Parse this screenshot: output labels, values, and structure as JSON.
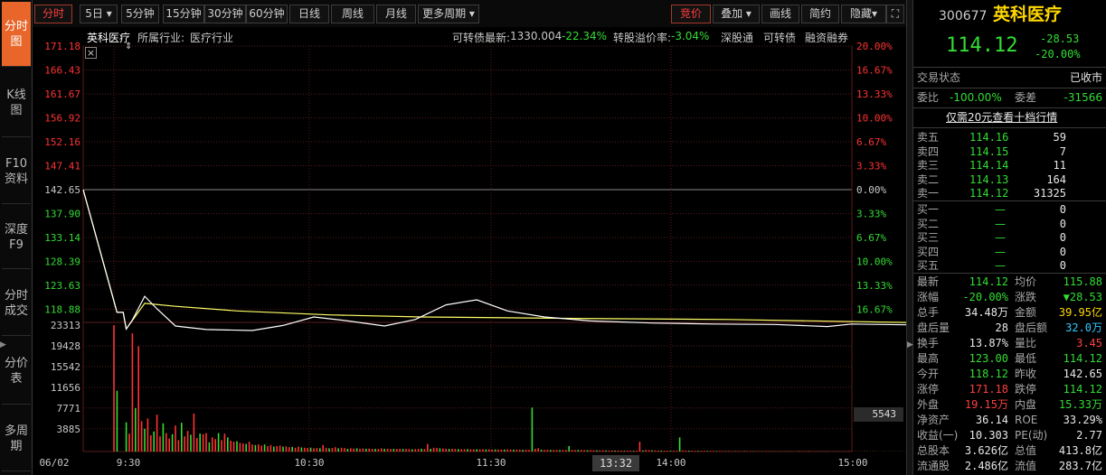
{
  "left_tabs": [
    {
      "label": "分时图",
      "active": true
    },
    {
      "label": "K线图",
      "active": false
    },
    {
      "label": "F10资料",
      "active": false
    },
    {
      "label": "深度F9",
      "active": false
    },
    {
      "label": "分时成交",
      "active": false
    },
    {
      "label": "分价表",
      "active": false
    },
    {
      "label": "多周期",
      "active": false
    }
  ],
  "toolbar": {
    "fenshi": "分时",
    "five_day": "5日",
    "five_day_arrow": "▾",
    "m5": "5分钟",
    "m15": "15分钟",
    "m30": "30分钟",
    "m60": "60分钟",
    "day": "日线",
    "week": "周线",
    "month": "月线",
    "more": "更多周期",
    "more_arrow": "▾",
    "jingjia": "竞价",
    "diejia": "叠加",
    "diejia_arrow": "▾",
    "huaxian": "画线",
    "jianyue": "简约",
    "yincang": "隐藏",
    "yincang_arrow": "▾",
    "fullscreen_icon": "⛶"
  },
  "infobar": {
    "stock_name": "英科医疗",
    "industry_label": "所属行业:",
    "industry_value": "医疗行业",
    "convert_label": "可转债最新:",
    "convert_price": "1330.004",
    "convert_pct": "-22.34%",
    "premium_label": "转股溢价率:",
    "premium_value": "-3.04%",
    "link1": "深股通",
    "link2": "可转债",
    "link3": "融资融券"
  },
  "chart_data": {
    "type": "line",
    "price_axis": {
      "labels": [
        "171.18",
        "166.43",
        "161.67",
        "156.92",
        "152.16",
        "147.41",
        "142.65",
        "137.90",
        "133.14",
        "128.39",
        "123.63",
        "118.88"
      ],
      "pct_labels": [
        "20.00%",
        "16.67%",
        "13.33%",
        "10.00%",
        "6.67%",
        "3.33%",
        "0.00%",
        "3.33%",
        "6.67%",
        "10.00%",
        "13.33%",
        "16.67%"
      ],
      "prev_close": 142.65,
      "ylim": [
        114.12,
        171.18
      ]
    },
    "volume_axis": {
      "labels": [
        "23313",
        "19428",
        "15542",
        "11656",
        "7771",
        "3885"
      ],
      "ylim": [
        0,
        23313
      ]
    },
    "x_labels": [
      "06/02",
      "9:30",
      "10:30",
      "11:30",
      "13:32",
      "14:00",
      "15:00"
    ],
    "price_series": {
      "name": "price",
      "values": [
        [
          0,
          142.65
        ],
        [
          1,
          118.3
        ],
        [
          3,
          118.3
        ],
        [
          4,
          115.0
        ],
        [
          6,
          116.8
        ],
        [
          10,
          121.5
        ],
        [
          14,
          119.0
        ],
        [
          20,
          115.6
        ],
        [
          30,
          114.9
        ],
        [
          45,
          114.7
        ],
        [
          55,
          115.7
        ],
        [
          65,
          117.4
        ],
        [
          75,
          116.7
        ],
        [
          88,
          115.6
        ],
        [
          98,
          116.9
        ],
        [
          108,
          119.8
        ],
        [
          118,
          120.8
        ],
        [
          128,
          118.6
        ],
        [
          140,
          117.4
        ],
        [
          155,
          116.6
        ],
        [
          175,
          116.2
        ],
        [
          195,
          116.0
        ],
        [
          215,
          115.9
        ],
        [
          232,
          115.5
        ],
        [
          240,
          116.0
        ],
        [
          262,
          115.8
        ],
        [
          268,
          114.4
        ],
        [
          420,
          114.12
        ]
      ]
    },
    "avg_series": {
      "name": "avg",
      "values": [
        [
          0,
          142.65
        ],
        [
          1,
          118.3
        ],
        [
          3,
          118.3
        ],
        [
          4,
          115.0
        ],
        [
          10,
          120.1
        ],
        [
          20,
          119.5
        ],
        [
          40,
          118.6
        ],
        [
          70,
          117.8
        ],
        [
          100,
          117.4
        ],
        [
          150,
          117.1
        ],
        [
          200,
          116.9
        ],
        [
          268,
          116.2
        ],
        [
          300,
          116.1
        ],
        [
          420,
          115.88
        ]
      ]
    },
    "volume_bars": [
      23313,
      11200,
      0,
      0,
      5400,
      3300,
      21800,
      8000,
      19400,
      5600,
      4200,
      6100,
      3000,
      3700,
      6800,
      2800,
      5200,
      3400,
      2400,
      3200,
      4800,
      2100,
      5300,
      2800,
      3800,
      3100,
      7000,
      2500,
      3300,
      3200,
      3400,
      1700,
      2600,
      2300,
      3400,
      2100,
      3300,
      2600,
      2000,
      1800,
      1900,
      1600,
      1500,
      1400,
      1800,
      1300,
      1200,
      1300,
      1100,
      1300,
      1000,
      1200,
      900,
      1000,
      1100,
      900,
      950,
      800,
      850,
      700,
      900,
      750,
      700,
      650,
      700,
      600,
      650,
      600,
      1200,
      700,
      600,
      650,
      800,
      600,
      700,
      650,
      500,
      600,
      550,
      600,
      500,
      560,
      520,
      540,
      500,
      500,
      480,
      600,
      500,
      520,
      460,
      500,
      480,
      500,
      470,
      480,
      460,
      400,
      450,
      480,
      520,
      460,
      1400,
      500,
      700,
      650,
      600,
      560,
      520,
      480,
      500,
      470,
      460,
      440,
      430,
      460,
      420,
      400,
      420,
      400,
      410,
      400,
      400,
      380,
      390,
      380,
      350,
      360,
      400,
      380,
      350,
      340,
      330,
      320,
      340,
      300,
      8100,
      500,
      600,
      350,
      300,
      320,
      300,
      280,
      290,
      260,
      270,
      280,
      1000,
      300,
      280,
      300,
      280,
      260,
      250,
      270,
      230,
      220,
      210,
      240,
      200,
      190,
      200,
      180,
      190,
      170,
      160,
      180,
      170,
      150,
      160,
      1800,
      200,
      300,
      250,
      220,
      200,
      180,
      170,
      160,
      150,
      140,
      150,
      130,
      2600,
      200,
      180,
      160,
      150,
      140,
      130,
      140,
      130,
      120,
      110,
      120,
      100,
      110,
      100,
      90,
      100,
      90,
      80,
      90,
      80,
      100,
      90,
      80,
      70,
      60,
      70,
      60,
      80,
      70,
      60,
      50,
      60,
      50,
      60,
      70,
      60,
      50,
      60,
      70,
      60,
      80,
      70,
      60,
      50,
      60,
      50,
      60,
      50,
      40,
      50,
      40,
      50,
      40,
      50,
      60,
      50,
      40,
      50,
      40,
      60,
      50,
      40,
      50,
      40,
      30,
      40,
      30,
      40,
      30,
      40,
      30,
      40,
      30,
      40,
      30,
      40,
      30,
      40,
      30,
      40,
      30,
      40,
      30,
      40,
      50,
      60,
      50,
      40,
      50,
      40,
      50,
      40,
      30,
      40,
      30,
      40,
      30,
      40,
      30,
      40,
      30,
      40,
      30,
      40,
      30,
      40,
      30,
      40,
      30,
      40,
      30,
      40,
      30,
      40,
      30,
      40,
      30,
      40,
      30,
      40,
      30,
      40,
      30,
      40,
      30,
      40,
      30,
      40,
      30,
      40,
      30,
      40,
      30,
      40,
      30,
      40,
      30,
      40,
      30,
      40,
      30,
      40,
      30,
      40,
      30,
      40,
      30,
      40,
      30,
      40,
      30,
      40,
      30,
      40,
      30,
      40,
      30,
      40,
      30,
      40,
      30,
      40,
      30,
      40,
      30,
      40,
      30,
      40,
      30,
      40,
      30,
      40,
      30,
      40,
      30,
      40,
      30,
      40,
      30,
      40,
      30,
      40,
      30,
      40,
      30,
      40,
      30,
      40,
      30,
      40,
      30,
      40,
      30,
      40,
      30,
      40,
      30,
      40,
      30,
      40,
      30,
      40,
      30,
      40,
      30,
      40,
      30,
      40,
      30,
      40,
      30,
      40,
      30,
      40,
      30,
      40,
      30,
      40,
      30,
      40,
      30,
      40,
      30,
      40,
      30,
      40,
      30,
      40,
      30,
      40,
      30,
      40,
      30,
      40,
      30,
      40,
      30,
      40,
      30,
      40,
      30,
      40,
      30,
      40,
      30,
      40,
      30,
      40,
      30,
      40,
      30,
      40,
      30,
      40,
      30
    ],
    "volume_colors_note": "red-up-green-down",
    "current_volume": "5543",
    "crosshair_time": "13:32",
    "colors": {
      "price_line": "#ffffff",
      "avg_line": "#ffff66",
      "up": "#ff3333",
      "down": "#33dd33",
      "grid": "#5a1a1a"
    }
  },
  "right_panel": {
    "code": "300677",
    "name": "英科医疗",
    "price": "114.12",
    "change": "-28.53",
    "change_pct": "-20.00%",
    "status_label": "交易状态",
    "status_value": "已收市",
    "weibi_label": "委比",
    "weibi_value": "-100.00%",
    "weicha_label": "委差",
    "weicha_value": "-31566",
    "promo": "仅需20元查看十档行情",
    "sells": [
      {
        "label": "卖五",
        "price": "114.16",
        "vol": "59"
      },
      {
        "label": "卖四",
        "price": "114.15",
        "vol": "7"
      },
      {
        "label": "卖三",
        "price": "114.14",
        "vol": "11"
      },
      {
        "label": "卖二",
        "price": "114.13",
        "vol": "164"
      },
      {
        "label": "卖一",
        "price": "114.12",
        "vol": "31325"
      }
    ],
    "buys": [
      {
        "label": "买一",
        "price": "—",
        "vol": "0"
      },
      {
        "label": "买二",
        "price": "—",
        "vol": "0"
      },
      {
        "label": "买三",
        "price": "—",
        "vol": "0"
      },
      {
        "label": "买四",
        "price": "—",
        "vol": "0"
      },
      {
        "label": "买五",
        "price": "—",
        "vol": "0"
      }
    ],
    "stats": [
      {
        "l1": "最新",
        "v1": "114.12",
        "c1": "green",
        "l2": "均价",
        "v2": "115.88",
        "c2": "green"
      },
      {
        "l1": "涨幅",
        "v1": "-20.00%",
        "c1": "green",
        "l2": "涨跌",
        "v2": "▼28.53",
        "c2": "green"
      },
      {
        "l1": "总手",
        "v1": "34.48万",
        "c1": "white",
        "l2": "金额",
        "v2": "39.95亿",
        "c2": "yellow"
      },
      {
        "l1": "盘后量",
        "v1": "28",
        "c1": "white",
        "l2": "盘后额",
        "v2": "32.0万",
        "c2": "cyan"
      },
      {
        "l1": "换手",
        "v1": "13.87%",
        "c1": "white",
        "l2": "量比",
        "v2": "3.45",
        "c2": "red-t"
      },
      {
        "l1": "最高",
        "v1": "123.00",
        "c1": "green",
        "l2": "最低",
        "v2": "114.12",
        "c2": "green"
      },
      {
        "l1": "今开",
        "v1": "118.12",
        "c1": "green",
        "l2": "昨收",
        "v2": "142.65",
        "c2": "white"
      },
      {
        "l1": "涨停",
        "v1": "171.18",
        "c1": "red-t",
        "l2": "跌停",
        "v2": "114.12",
        "c2": "green"
      },
      {
        "l1": "外盘",
        "v1": "19.15万",
        "c1": "red-t",
        "l2": "内盘",
        "v2": "15.33万",
        "c2": "green"
      },
      {
        "l1": "净资产",
        "v1": "36.14",
        "c1": "white",
        "l2": "ROE",
        "v2": "33.29%",
        "c2": "white"
      },
      {
        "l1": "收益(一)",
        "v1": "10.303",
        "c1": "white",
        "l2": "PE(动)",
        "v2": "2.77",
        "c2": "white"
      },
      {
        "l1": "总股本",
        "v1": "3.626亿",
        "c1": "white",
        "l2": "总值",
        "v2": "413.8亿",
        "c2": "white"
      },
      {
        "l1": "流通股",
        "v1": "2.486亿",
        "c1": "white",
        "l2": "流值",
        "v2": "283.7亿",
        "c2": "white"
      }
    ]
  }
}
